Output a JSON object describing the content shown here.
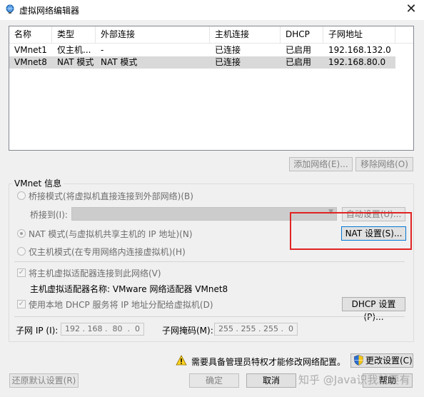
{
  "window": {
    "title": "虚拟网络编辑器",
    "close_glyph": "✕"
  },
  "list": {
    "headers": [
      "名称",
      "类型",
      "外部连接",
      "主机连接",
      "DHCP",
      "子网地址"
    ],
    "rows": [
      {
        "name": "VMnet1",
        "type": "仅主机...",
        "external": "-",
        "host": "已连接",
        "dhcp": "已启用",
        "subnet": "192.168.132.0",
        "selected": false
      },
      {
        "name": "VMnet8",
        "type": "NAT 模式",
        "external": "NAT 模式",
        "host": "已连接",
        "dhcp": "已启用",
        "subnet": "192.168.80.0",
        "selected": true
      }
    ]
  },
  "buttons": {
    "add_network": "添加网络(E)...",
    "remove_network": "移除网络(O)",
    "auto_settings": "自动设置(U)...",
    "nat_settings": "NAT 设置(S)...",
    "dhcp_settings": "DHCP 设置(P)...",
    "change_settings": "更改设置(C)",
    "restore_defaults": "还原默认设置(R)",
    "ok": "确定",
    "cancel": "取消",
    "help": "帮助"
  },
  "vmnet_info": {
    "group_title": "VMnet 信息",
    "bridged_mode": "桥接模式(将虚拟机直接连接到外部网络)(B)",
    "bridged_to_label": "桥接到(I):",
    "nat_mode": "NAT 模式(与虚拟机共享主机的 IP 地址)(N)",
    "host_only_mode": "仅主机模式(在专用网络内连接虚拟机)(H)",
    "selected_mode": "nat",
    "connect_host_adapter": "将主机虚拟适配器连接到此网络(V)",
    "connect_host_adapter_checked": true,
    "host_adapter_name": "主机虚拟适配器名称: VMware 网络适配器 VMnet8",
    "use_dhcp": "使用本地 DHCP 服务将 IP 地址分配给虚拟机(D)",
    "use_dhcp_checked": true,
    "subnet_ip_label": "子网 IP (I):",
    "subnet_ip": "192 . 168 .  80  .  0",
    "subnet_mask_label": "子网掩码(M):",
    "subnet_mask": "255 . 255 . 255 .  0"
  },
  "footer": {
    "admin_warning": "需要具备管理员特权才能修改网络配置。",
    "watermark": "知乎 @Java识我就要有"
  },
  "colors": {
    "highlight": "#e02424",
    "focus_border": "#0078d7",
    "selection": "#d9d9d9"
  },
  "icons": {
    "app": "vmware-network-icon",
    "warning": "warning-icon",
    "shield": "uac-shield-icon"
  }
}
